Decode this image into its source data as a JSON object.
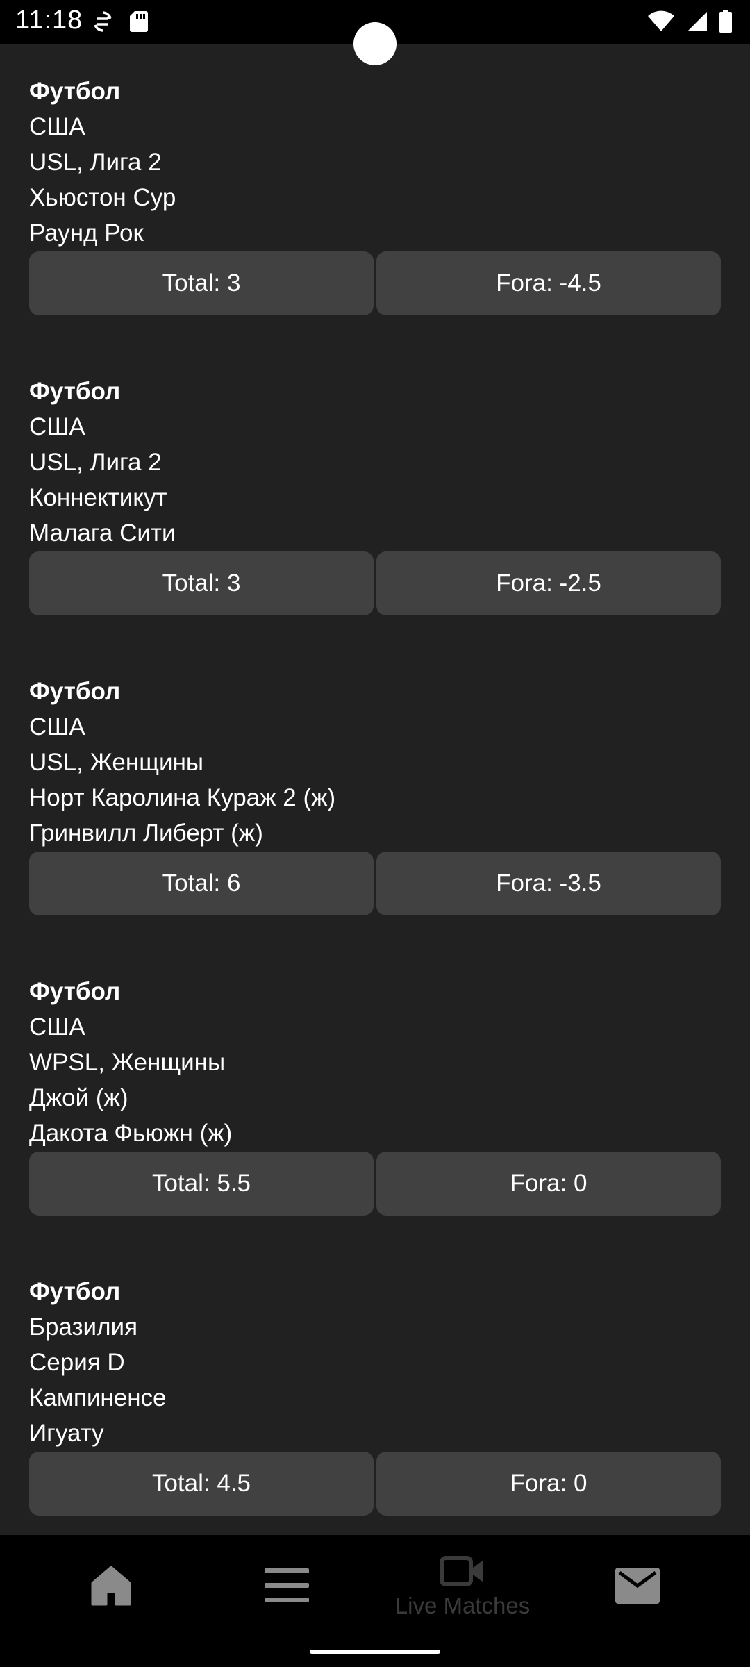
{
  "status_bar": {
    "time": "11:18",
    "left_icons": [
      "sync-icon",
      "sd-card-icon"
    ],
    "right_icons": [
      "wifi-icon",
      "signal-icon",
      "battery-icon"
    ]
  },
  "matches": [
    {
      "sport": "Футбол",
      "country": "США",
      "league": "USL, Лига 2",
      "team_home": "Хьюстон Сур",
      "team_away": "Раунд Рок",
      "total": "Total: 3",
      "fora": "Fora: -4.5"
    },
    {
      "sport": "Футбол",
      "country": "США",
      "league": "USL, Лига 2",
      "team_home": "Коннектикут",
      "team_away": "Малага Сити",
      "total": "Total: 3",
      "fora": "Fora: -2.5"
    },
    {
      "sport": "Футбол",
      "country": "США",
      "league": "USL, Женщины",
      "team_home": "Норт Каролина Кураж 2 (ж)",
      "team_away": "Гринвилл Либерт (ж)",
      "total": "Total: 6",
      "fora": "Fora: -3.5"
    },
    {
      "sport": "Футбол",
      "country": "США",
      "league": "WPSL, Женщины",
      "team_home": "Джой (ж)",
      "team_away": "Дакота Фьюжн (ж)",
      "total": "Total: 5.5",
      "fora": "Fora: 0"
    },
    {
      "sport": "Футбол",
      "country": "Бразилия",
      "league": "Серия D",
      "team_home": "Кампиненсе",
      "team_away": "Игуату",
      "total": "Total: 4.5",
      "fora": "Fora: 0"
    }
  ],
  "bottom_nav": {
    "items": [
      {
        "icon": "home-icon",
        "label": ""
      },
      {
        "icon": "menu-icon",
        "label": ""
      },
      {
        "icon": "video-camera-icon",
        "label": "Live Matches"
      },
      {
        "icon": "mail-icon",
        "label": ""
      }
    ]
  },
  "colors": {
    "background": "#212121",
    "button": "#414141",
    "nav_background": "#000000",
    "nav_icon_active": "#8a8a8a",
    "nav_icon_inactive": "#3a3a3a"
  }
}
